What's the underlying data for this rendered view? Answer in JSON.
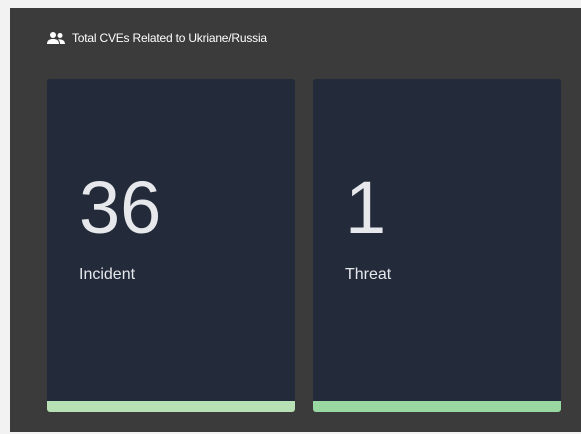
{
  "panel": {
    "title": "Total CVEs Related to Ukriane/Russia",
    "icon": "users-icon"
  },
  "cards": [
    {
      "value": "36",
      "label": "Incident",
      "bar_color": "#b7e0b4"
    },
    {
      "value": "1",
      "label": "Threat",
      "bar_color": "#9ad8a2"
    }
  ],
  "colors": {
    "panel_bg": "#3b3b3b",
    "card_bg": "#232a39",
    "text": "#e6e8ec"
  }
}
